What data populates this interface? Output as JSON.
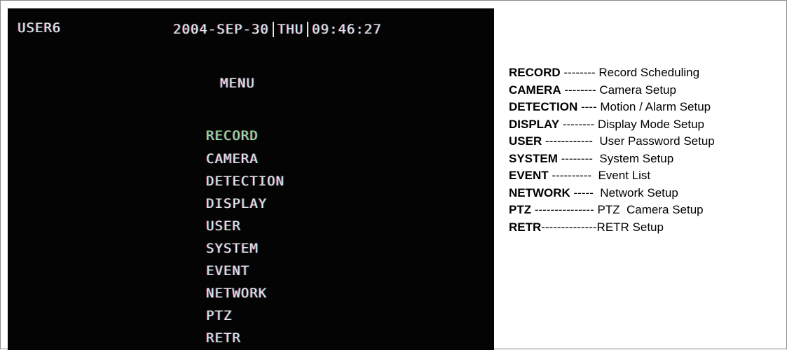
{
  "screen": {
    "user": "USER6",
    "date": "2004-SEP-30",
    "day": "THU",
    "time": "09:46:27",
    "title": "MENU"
  },
  "menu": {
    "items": [
      {
        "label": "RECORD",
        "selected": true
      },
      {
        "label": "CAMERA"
      },
      {
        "label": "DETECTION"
      },
      {
        "label": "DISPLAY"
      },
      {
        "label": "USER"
      },
      {
        "label": "SYSTEM"
      },
      {
        "label": "EVENT"
      },
      {
        "label": "NETWORK"
      },
      {
        "label": "PTZ"
      },
      {
        "label": "RETR"
      }
    ]
  },
  "legend": {
    "items": [
      {
        "key": "RECORD",
        "rest": " -------- Record Scheduling"
      },
      {
        "key": "CAMERA",
        "rest": " -------- Camera Setup"
      },
      {
        "key": "DETECTION",
        "rest": " ---- Motion / Alarm Setup"
      },
      {
        "key": "DISPLAY",
        "rest": " -------- Display Mode Setup"
      },
      {
        "key": "USER",
        "rest": " ------------  User Password Setup"
      },
      {
        "key": "SYSTEM",
        "rest": " --------  System Setup"
      },
      {
        "key": "EVENT",
        "rest": " ----------  Event List"
      },
      {
        "key": "NETWORK",
        "rest": " -----  Network Setup"
      },
      {
        "key": "PTZ",
        "rest": " --------------- PTZ  Camera Setup"
      },
      {
        "key": "RETR",
        "rest": "--------------RETR Setup"
      }
    ]
  },
  "colors": {
    "screen_background": "#040404",
    "osd_text": "#e6e6e6",
    "selected_item": "#9fe39a"
  }
}
